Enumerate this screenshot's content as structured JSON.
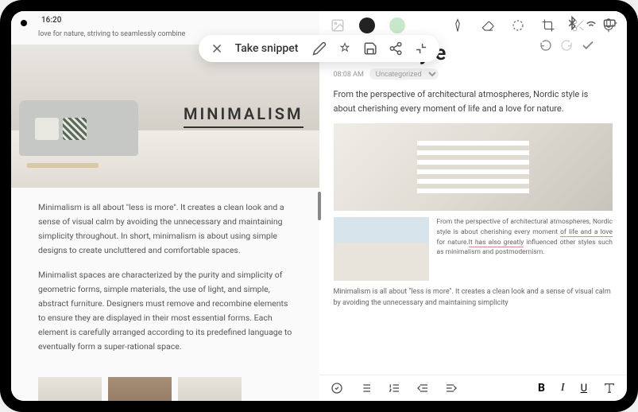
{
  "status": {
    "time": "16:20",
    "icons": [
      "bluetooth-icon",
      "wifi-icon",
      "battery-icon"
    ]
  },
  "snippet_toolbar": {
    "label": "Take snippet"
  },
  "left_pane": {
    "header_text": "love for nature, striving to seamlessly combine",
    "hero_title": "MINIMALISM",
    "paragraph1": "Minimalism is all about \"less is more\". It creates a clean look and a sense of visual calm by avoiding the unnecessary and maintaining simplicity throughout. In short, minimalism is about using simple designs to create uncluttered and comfortable spaces.",
    "paragraph2": "Minimalist spaces are characterized by the purity and simplicity of geometric forms, simple materials, the use of light, and simple, abstract furniture. Designers must remove and recombine elements to ensure they are displayed in their most essential forms. Each element is carefully arranged according to its predefined language to eventually form a super-rational space."
  },
  "right_pane": {
    "title": "Nordic Style",
    "time": "08:08 AM",
    "category": "Uncategorized",
    "intro": "From the perspective of architectural atmospheres, Nordic style is about cherishing every moment of life and a love for nature.",
    "side_text_1": "From the perspective of architectural atmospheres, Nordic style is about cherishing every moment ",
    "side_text_2": "of life and a love",
    "side_text_3": " for nature.",
    "side_text_4": "It has also greatly",
    "side_text_5": " influenced other styles such as minimalism and postmodernism.",
    "bottom_text": "Minimalism is all about \"less is more\". It creates a clean look and a sense of visual calm by avoiding the unnecessary and maintaining simplicity"
  },
  "format_toolbar": {
    "bold": "B",
    "italic": "I",
    "underline": "U"
  }
}
